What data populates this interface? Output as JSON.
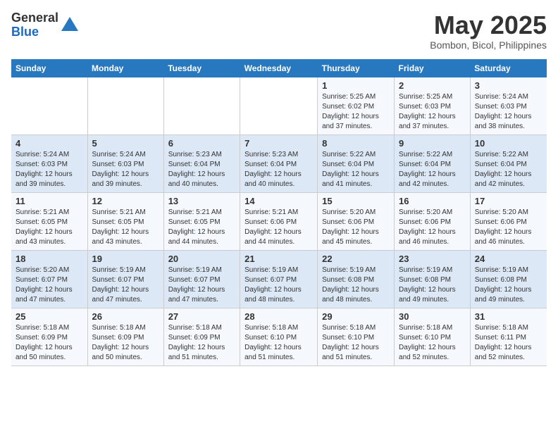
{
  "header": {
    "logo_general": "General",
    "logo_blue": "Blue",
    "month_title": "May 2025",
    "location": "Bombon, Bicol, Philippines"
  },
  "days_of_week": [
    "Sunday",
    "Monday",
    "Tuesday",
    "Wednesday",
    "Thursday",
    "Friday",
    "Saturday"
  ],
  "weeks": [
    [
      {
        "day": "",
        "detail": ""
      },
      {
        "day": "",
        "detail": ""
      },
      {
        "day": "",
        "detail": ""
      },
      {
        "day": "",
        "detail": ""
      },
      {
        "day": "1",
        "detail": "Sunrise: 5:25 AM\nSunset: 6:02 PM\nDaylight: 12 hours\nand 37 minutes."
      },
      {
        "day": "2",
        "detail": "Sunrise: 5:25 AM\nSunset: 6:03 PM\nDaylight: 12 hours\nand 37 minutes."
      },
      {
        "day": "3",
        "detail": "Sunrise: 5:24 AM\nSunset: 6:03 PM\nDaylight: 12 hours\nand 38 minutes."
      }
    ],
    [
      {
        "day": "4",
        "detail": "Sunrise: 5:24 AM\nSunset: 6:03 PM\nDaylight: 12 hours\nand 39 minutes."
      },
      {
        "day": "5",
        "detail": "Sunrise: 5:24 AM\nSunset: 6:03 PM\nDaylight: 12 hours\nand 39 minutes."
      },
      {
        "day": "6",
        "detail": "Sunrise: 5:23 AM\nSunset: 6:04 PM\nDaylight: 12 hours\nand 40 minutes."
      },
      {
        "day": "7",
        "detail": "Sunrise: 5:23 AM\nSunset: 6:04 PM\nDaylight: 12 hours\nand 40 minutes."
      },
      {
        "day": "8",
        "detail": "Sunrise: 5:22 AM\nSunset: 6:04 PM\nDaylight: 12 hours\nand 41 minutes."
      },
      {
        "day": "9",
        "detail": "Sunrise: 5:22 AM\nSunset: 6:04 PM\nDaylight: 12 hours\nand 42 minutes."
      },
      {
        "day": "10",
        "detail": "Sunrise: 5:22 AM\nSunset: 6:04 PM\nDaylight: 12 hours\nand 42 minutes."
      }
    ],
    [
      {
        "day": "11",
        "detail": "Sunrise: 5:21 AM\nSunset: 6:05 PM\nDaylight: 12 hours\nand 43 minutes."
      },
      {
        "day": "12",
        "detail": "Sunrise: 5:21 AM\nSunset: 6:05 PM\nDaylight: 12 hours\nand 43 minutes."
      },
      {
        "day": "13",
        "detail": "Sunrise: 5:21 AM\nSunset: 6:05 PM\nDaylight: 12 hours\nand 44 minutes."
      },
      {
        "day": "14",
        "detail": "Sunrise: 5:21 AM\nSunset: 6:06 PM\nDaylight: 12 hours\nand 44 minutes."
      },
      {
        "day": "15",
        "detail": "Sunrise: 5:20 AM\nSunset: 6:06 PM\nDaylight: 12 hours\nand 45 minutes."
      },
      {
        "day": "16",
        "detail": "Sunrise: 5:20 AM\nSunset: 6:06 PM\nDaylight: 12 hours\nand 46 minutes."
      },
      {
        "day": "17",
        "detail": "Sunrise: 5:20 AM\nSunset: 6:06 PM\nDaylight: 12 hours\nand 46 minutes."
      }
    ],
    [
      {
        "day": "18",
        "detail": "Sunrise: 5:20 AM\nSunset: 6:07 PM\nDaylight: 12 hours\nand 47 minutes."
      },
      {
        "day": "19",
        "detail": "Sunrise: 5:19 AM\nSunset: 6:07 PM\nDaylight: 12 hours\nand 47 minutes."
      },
      {
        "day": "20",
        "detail": "Sunrise: 5:19 AM\nSunset: 6:07 PM\nDaylight: 12 hours\nand 47 minutes."
      },
      {
        "day": "21",
        "detail": "Sunrise: 5:19 AM\nSunset: 6:07 PM\nDaylight: 12 hours\nand 48 minutes."
      },
      {
        "day": "22",
        "detail": "Sunrise: 5:19 AM\nSunset: 6:08 PM\nDaylight: 12 hours\nand 48 minutes."
      },
      {
        "day": "23",
        "detail": "Sunrise: 5:19 AM\nSunset: 6:08 PM\nDaylight: 12 hours\nand 49 minutes."
      },
      {
        "day": "24",
        "detail": "Sunrise: 5:19 AM\nSunset: 6:08 PM\nDaylight: 12 hours\nand 49 minutes."
      }
    ],
    [
      {
        "day": "25",
        "detail": "Sunrise: 5:18 AM\nSunset: 6:09 PM\nDaylight: 12 hours\nand 50 minutes."
      },
      {
        "day": "26",
        "detail": "Sunrise: 5:18 AM\nSunset: 6:09 PM\nDaylight: 12 hours\nand 50 minutes."
      },
      {
        "day": "27",
        "detail": "Sunrise: 5:18 AM\nSunset: 6:09 PM\nDaylight: 12 hours\nand 51 minutes."
      },
      {
        "day": "28",
        "detail": "Sunrise: 5:18 AM\nSunset: 6:10 PM\nDaylight: 12 hours\nand 51 minutes."
      },
      {
        "day": "29",
        "detail": "Sunrise: 5:18 AM\nSunset: 6:10 PM\nDaylight: 12 hours\nand 51 minutes."
      },
      {
        "day": "30",
        "detail": "Sunrise: 5:18 AM\nSunset: 6:10 PM\nDaylight: 12 hours\nand 52 minutes."
      },
      {
        "day": "31",
        "detail": "Sunrise: 5:18 AM\nSunset: 6:11 PM\nDaylight: 12 hours\nand 52 minutes."
      }
    ]
  ]
}
